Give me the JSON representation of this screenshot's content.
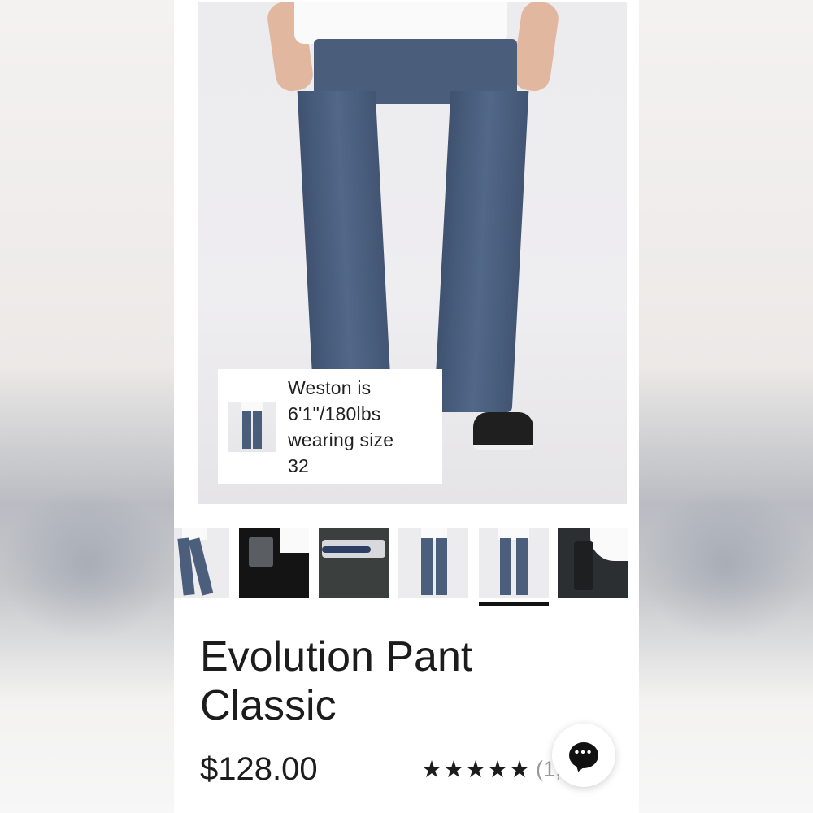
{
  "product": {
    "title_line1": "Evolution Pant",
    "title_line2": "Classic",
    "price": "$128.00",
    "rating_stars": "★★★★★",
    "rating_value": 5,
    "review_count": "(1,000)"
  },
  "gallery": {
    "model_info": {
      "line1": "Weston is",
      "line2": "6'1\"/180lbs",
      "line3": "wearing size",
      "line4": "32"
    },
    "thumbnails": [
      {
        "name": "front-view"
      },
      {
        "name": "pocket-phone"
      },
      {
        "name": "passport-pocket"
      },
      {
        "name": "front-full"
      },
      {
        "name": "back-full",
        "selected": true
      },
      {
        "name": "zip-pocket"
      }
    ]
  },
  "chat": {
    "icon": "chat-icon",
    "dots": "•••"
  },
  "colors": {
    "pant": "#4a5e7c",
    "text": "#1c1c1c",
    "muted": "#9a9a9a"
  }
}
